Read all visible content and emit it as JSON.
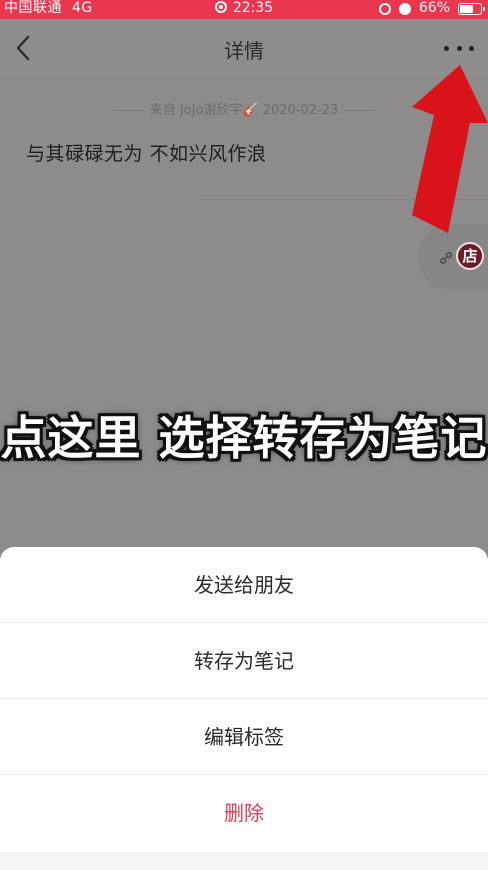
{
  "status_bar": {
    "carrier": "中国联通",
    "network": "4G",
    "time": "22:35",
    "battery": "66%",
    "battery_level": 0.66
  },
  "nav": {
    "title": "详情"
  },
  "note": {
    "source": "来自 JoJo谢欣宇🎸 2020-02-23",
    "text": "与其碌碌无为 不如兴风作浪"
  },
  "float_bar": {
    "store_label": "店"
  },
  "caption": "点这里 选择转存为笔记",
  "action_sheet": {
    "items": [
      {
        "label": "发送给朋友"
      },
      {
        "label": "转存为笔记"
      },
      {
        "label": "编辑标签"
      },
      {
        "label": "删除"
      }
    ]
  },
  "colors": {
    "status_bar": "#e8374f",
    "danger": "#e23b55",
    "arrow": "#d8141a"
  }
}
